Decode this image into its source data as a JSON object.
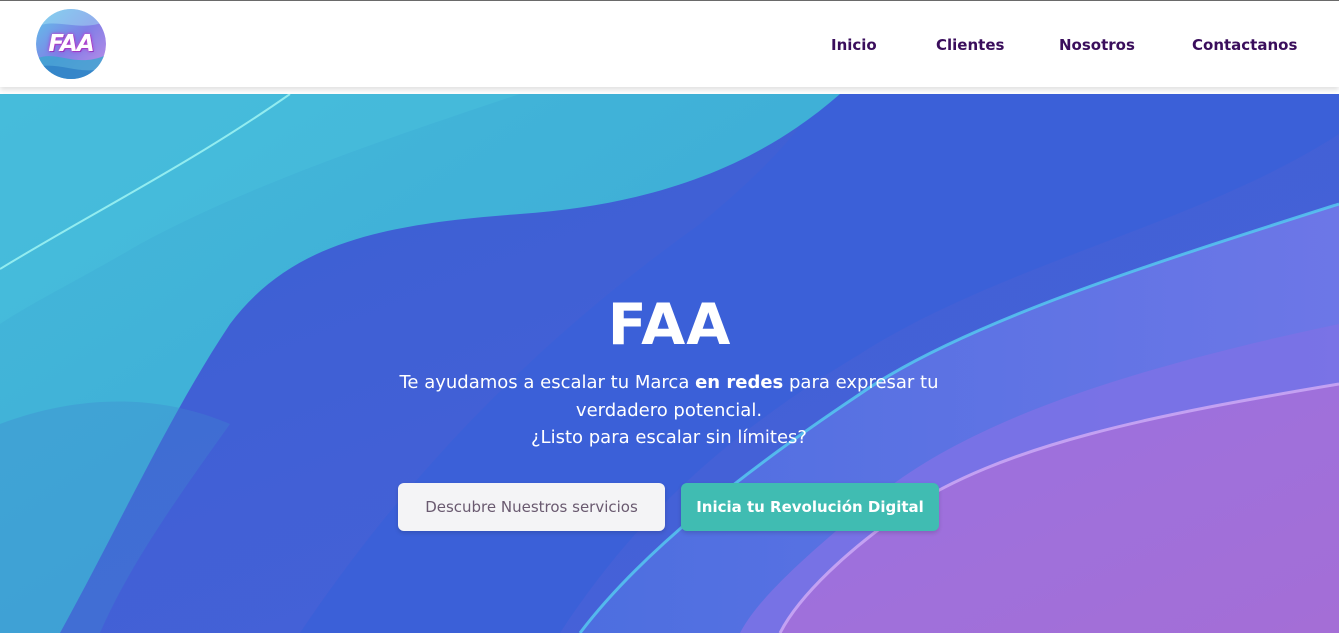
{
  "brand": {
    "logo_text": "FAA"
  },
  "nav": {
    "items": [
      {
        "label": "Inicio"
      },
      {
        "label": "Clientes"
      },
      {
        "label": "Nosotros"
      },
      {
        "label": "Contactanos"
      }
    ]
  },
  "hero": {
    "title": "FAA",
    "text_pre": "Te ayudamos a escalar tu Marca ",
    "text_bold": "en redes",
    "text_post": " para expresar tu verdadero potencial.",
    "text_line3": "¿Listo para escalar sin límites?",
    "buttons": {
      "services_label": "Descubre Nuestros servicios",
      "revolution_label": "Inicia tu Revolución Digital"
    }
  },
  "colors": {
    "nav_text": "#3a0e5c",
    "accent_button": "#40bcb2",
    "light_button": "#f4f4f6",
    "hero_blue": "#3e64d6",
    "hero_cyan": "#44b4d8",
    "hero_purple": "#a66fd8"
  }
}
